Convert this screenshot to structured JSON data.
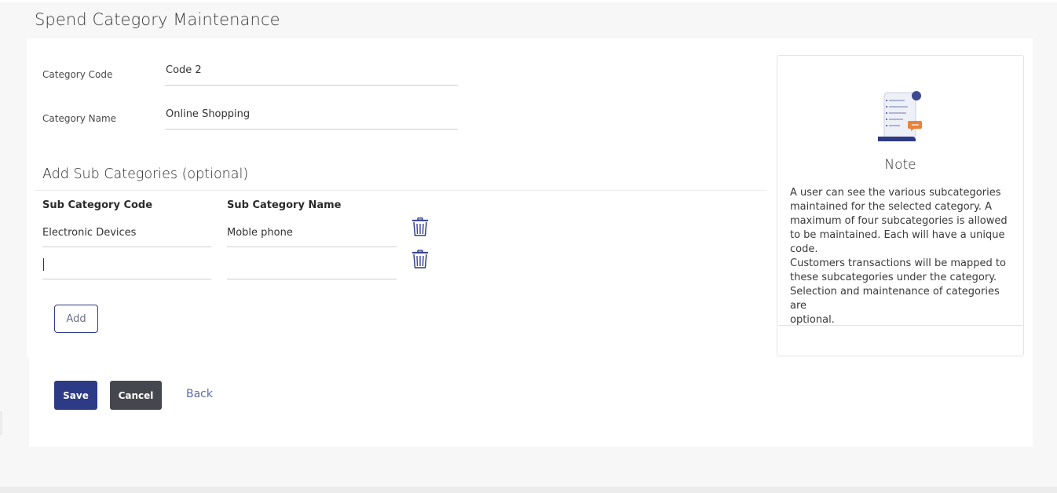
{
  "page": {
    "title": "Spend Category Maintenance"
  },
  "form": {
    "category_code_label": "Category Code",
    "category_code_value": "Code 2",
    "category_name_label": "Category Name",
    "category_name_value": "Online Shopping"
  },
  "subcategories": {
    "section_title": "Add Sub Categories (optional)",
    "code_header": "Sub Category Code",
    "name_header": "Sub Category Name",
    "rows": [
      {
        "code": "Electronic Devices",
        "name": "Moble phone",
        "delete_icon": "trash-icon"
      },
      {
        "code": "",
        "name": "",
        "delete_icon": "trash-icon"
      }
    ],
    "add_label": "Add"
  },
  "actions": {
    "save_label": "Save",
    "cancel_label": "Cancel",
    "back_label": "Back"
  },
  "note": {
    "icon": "note-document-icon",
    "title": "Note",
    "body_lines": [
      "A user can see the various subcategories",
      "maintained for the selected category. A",
      "maximum of four subcategories is allowed",
      "to be maintained. Each will have a unique",
      "code.",
      "Customers transactions will be mapped to",
      "these subcategories under the category.",
      "Selection and maintenance of categories are",
      "optional."
    ]
  },
  "colors": {
    "primary": "#2d3a85",
    "secondary_button": "#44474d",
    "link": "#5b6aa6",
    "accent_orange": "#e8833a"
  }
}
